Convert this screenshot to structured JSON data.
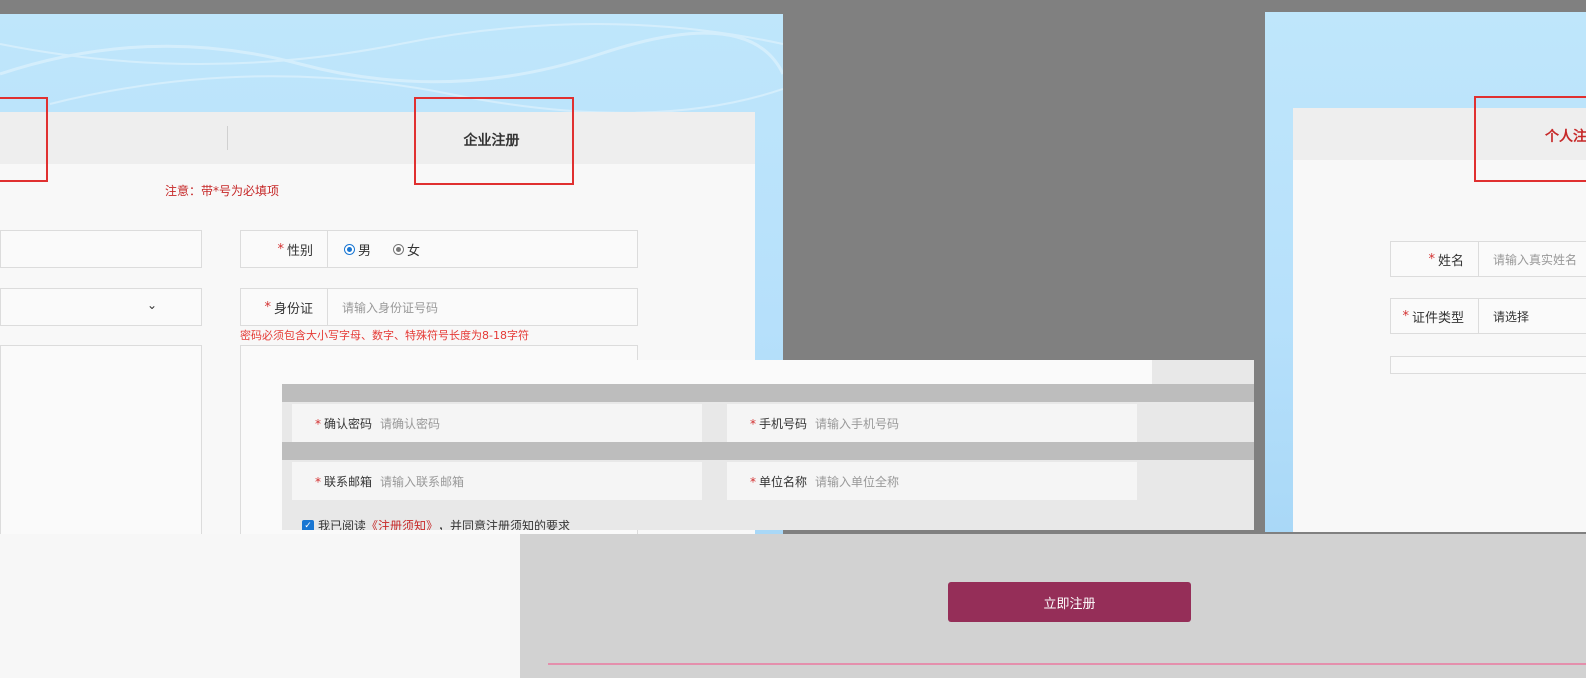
{
  "left_form": {
    "tab_company_label": "企业注册",
    "notice": "注意：带*号为必填项",
    "gender": {
      "label": "性别",
      "option_male": "男",
      "option_female": "女",
      "selected": "男"
    },
    "id_card": {
      "label": "身份证",
      "placeholder": "请输入身份证号码"
    },
    "password_hint": "密码必须包含大小写字母、数字、特殊符号长度为8-18字符"
  },
  "overlay": {
    "confirm_password": {
      "label": "确认密码",
      "placeholder": "请确认密码"
    },
    "contact_email": {
      "label": "联系邮箱",
      "placeholder": "请输入联系邮箱"
    },
    "mobile": {
      "label": "手机号码",
      "placeholder": "请输入手机号码"
    },
    "company_name": {
      "label": "单位名称",
      "placeholder": "请输入单位全称"
    },
    "agreement": {
      "prefix": "我已阅读",
      "link": "《注册须知》",
      "suffix": "，并同意注册须知的要求"
    }
  },
  "right_form": {
    "tab_personal_label": "个人注册",
    "name": {
      "label": "姓名",
      "placeholder": "请输入真实姓名"
    },
    "id_type": {
      "label": "证件类型",
      "value": "请选择"
    }
  },
  "submit_label": "立即注册",
  "colors": {
    "accent": "#952e58",
    "required": "#d32f2f",
    "highlight_box": "#e03030"
  }
}
